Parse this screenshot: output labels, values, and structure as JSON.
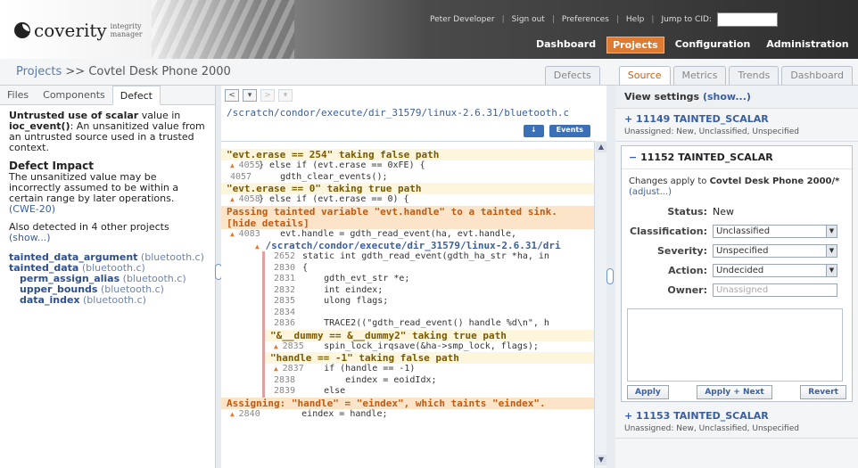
{
  "header": {
    "brand": "coverity",
    "tagline": "integrity manager",
    "util_nav": [
      "Peter Developer",
      "Sign out",
      "Preferences",
      "Help",
      "Jump to CID:"
    ],
    "main_nav": [
      "Dashboard",
      "Projects",
      "Configuration",
      "Administration"
    ],
    "active_main": "Projects"
  },
  "breadcrumb": {
    "link": "Projects",
    "sep": " >> ",
    "current": "Covtel Desk Phone 2000"
  },
  "view_tabs": [
    "Defects",
    "Source",
    "Metrics",
    "Trends",
    "Dashboard"
  ],
  "active_view_tab": "Source",
  "left": {
    "tabs": [
      "Files",
      "Components",
      "Defect"
    ],
    "active_tab": "Defect",
    "summary_bold1": "Untrusted use of scalar",
    "summary_mid": " value in ",
    "summary_bold2": "ioc_event()",
    "summary_rest": ": An unsanitized value from an untrusted source used in a trusted context.",
    "impact_title": "Defect Impact",
    "impact_text": "The unsanitized value may be incorrectly assumed to be within a certain range by later operations.",
    "cwe": "(CWE-20)",
    "also_detected": "Also detected in 4 other projects",
    "show_link": "(show...)",
    "events": [
      {
        "name": "tainted_data_argument",
        "file": " (bluetooth.c)",
        "level": 0
      },
      {
        "name": "tainted_data",
        "file": " (bluetooth.c)",
        "level": 0
      },
      {
        "name": "perm_assign_alias",
        "file": " (bluetooth.c)",
        "level": 1
      },
      {
        "name": "upper_bounds",
        "file": " (bluetooth.c)",
        "level": 1
      },
      {
        "name": "data_index",
        "file": " (bluetooth.c)",
        "level": 1
      }
    ]
  },
  "middle": {
    "file_path": "/scratch/condor/execute/dir_31579/linux-2.6.31/bluetooth.c",
    "btn_down": "↓",
    "btn_events": "Events",
    "ev1": "\"evt.erase == 254\" taking false path",
    "line1_no": "4055",
    "line1": "} else if (evt.erase == 0xFE) {",
    "line2_no": "4057",
    "line2": "    gdth_clear_events();",
    "ev2": "\"evt.erase == 0\" taking true path",
    "line3_no": "4058",
    "line3": "} else if (evt.erase == 0) {",
    "ev3": "Passing tainted variable \"evt.handle\" to a tainted sink. [hide details]",
    "line4_no": "4083",
    "line4": "    evt.handle = gdth_read_event(ha, evt.handle,",
    "nested_path": "/scratch/condor/execute/dir_31579/linux-2.6.31/dri",
    "n_lines": [
      {
        "no": "2652",
        "code": "static int gdth_read_event(gdth_ha_str *ha, in"
      },
      {
        "no": "2830",
        "code": "{"
      },
      {
        "no": "2831",
        "code": "    gdth_evt_str *e;"
      },
      {
        "no": "2832",
        "code": "    int eindex;"
      },
      {
        "no": "2835",
        "code": "    ulong flags;"
      },
      {
        "no": "2834",
        "code": ""
      },
      {
        "no": "2836",
        "code": "    TRACE2((\"gdth_read_event() handle %d\\n\", h"
      }
    ],
    "ev4": "\"&__dummy == &__dummy2\" taking true path",
    "line5_no": "2835",
    "line5": "    spin_lock_irqsave(&ha->smp_lock, flags);",
    "ev5": "\"handle == -1\" taking false path",
    "n_lines2": [
      {
        "no": "2837",
        "code": "    if (handle == -1)"
      },
      {
        "no": "2838",
        "code": "        eindex = eoidIdx;"
      },
      {
        "no": "2839",
        "code": "    else"
      }
    ],
    "ev6": "Assigning: \"handle\" = \"eindex\", which taints \"eindex\".",
    "line6_no": "2840",
    "line6": "        eindex = handle;"
  },
  "right": {
    "view_settings_label": "View settings",
    "view_settings_link": "(show...)",
    "occ_above": {
      "title": "+ 11149 TAINTED_SCALAR",
      "sub": "Unassigned: New, Unclassified, Unspecified"
    },
    "selected_title_prefix": "−",
    "selected_title": "11152 TAINTED_SCALAR",
    "apply_prefix": "Changes apply to ",
    "apply_project": "Covtel Desk Phone 2000/*",
    "apply_link": "(adjust...)",
    "status_label": "Status:",
    "status_value": "New",
    "classification_label": "Classification:",
    "classification_value": "Unclassified",
    "severity_label": "Severity:",
    "severity_value": "Unspecified",
    "action_label": "Action:",
    "action_value": "Undecided",
    "owner_label": "Owner:",
    "owner_placeholder": "Unassigned",
    "btn_apply": "Apply",
    "btn_apply_next": "Apply + Next",
    "btn_revert": "Revert",
    "occ_below": {
      "title": "+ 11153 TAINTED_SCALAR",
      "sub": "Unassigned: New, Unclassified, Unspecified"
    }
  }
}
